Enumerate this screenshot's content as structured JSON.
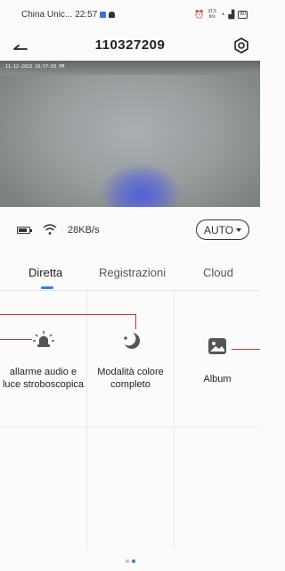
{
  "status_bar": {
    "carrier": "China Unic...",
    "time": "22:57",
    "net_speed_value": "31.5",
    "net_speed_unit": "K/s",
    "battery": "80"
  },
  "header": {
    "title": "110327209"
  },
  "video": {
    "timestamp": "11-12-2023 10:57:03 PM"
  },
  "info_bar": {
    "speed": "28KB/s",
    "quality_button": "AUTO"
  },
  "tabs": [
    {
      "label": "Diretta",
      "active": true
    },
    {
      "label": "Registrazioni",
      "active": false
    },
    {
      "label": "Cloud",
      "active": false
    }
  ],
  "features": [
    {
      "label_line1": "allarme audio e",
      "label_line2": "luce stroboscopica",
      "icon": "siren-icon"
    },
    {
      "label_line1": "Modalità colore",
      "label_line2": "completo",
      "icon": "moon-star-icon"
    },
    {
      "label_line1": "Album",
      "label_line2": "",
      "icon": "image-icon"
    }
  ],
  "colors": {
    "accent": "#3b7ccf",
    "annotation_red": "#c0392b",
    "icon_gray": "#555555"
  }
}
